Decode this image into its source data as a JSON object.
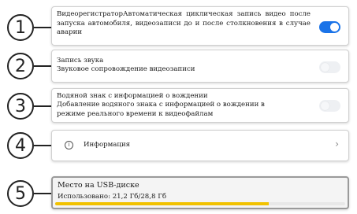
{
  "items": [
    {
      "number": "1",
      "title": "ВидеорегистраторАвтоматическая циклическая запись видео после запуска автомобиля, видеозаписи до и после столкновения в случае аварии",
      "toggle": "on"
    },
    {
      "number": "2",
      "title": "Запись звука",
      "subtitle": "Звуковое сопровождение видеозаписи",
      "toggle": "off"
    },
    {
      "number": "3",
      "title": "Водяной знак с информацией о вождении",
      "subtitle": "Добавление водяного знака с информацией о вождении в режиме реального времени к видеофайлам",
      "toggle": "off"
    },
    {
      "number": "4",
      "label": "Информация",
      "icon": "info-icon",
      "chevron": "›"
    },
    {
      "number": "5",
      "title": "Место на USB-диске",
      "usage": "Использовано: 21,2 Гб/28,8 Гб",
      "usage_fraction": 0.736
    }
  ],
  "colors": {
    "accent": "#1a73e8",
    "storage_bar": "#f2c200"
  }
}
